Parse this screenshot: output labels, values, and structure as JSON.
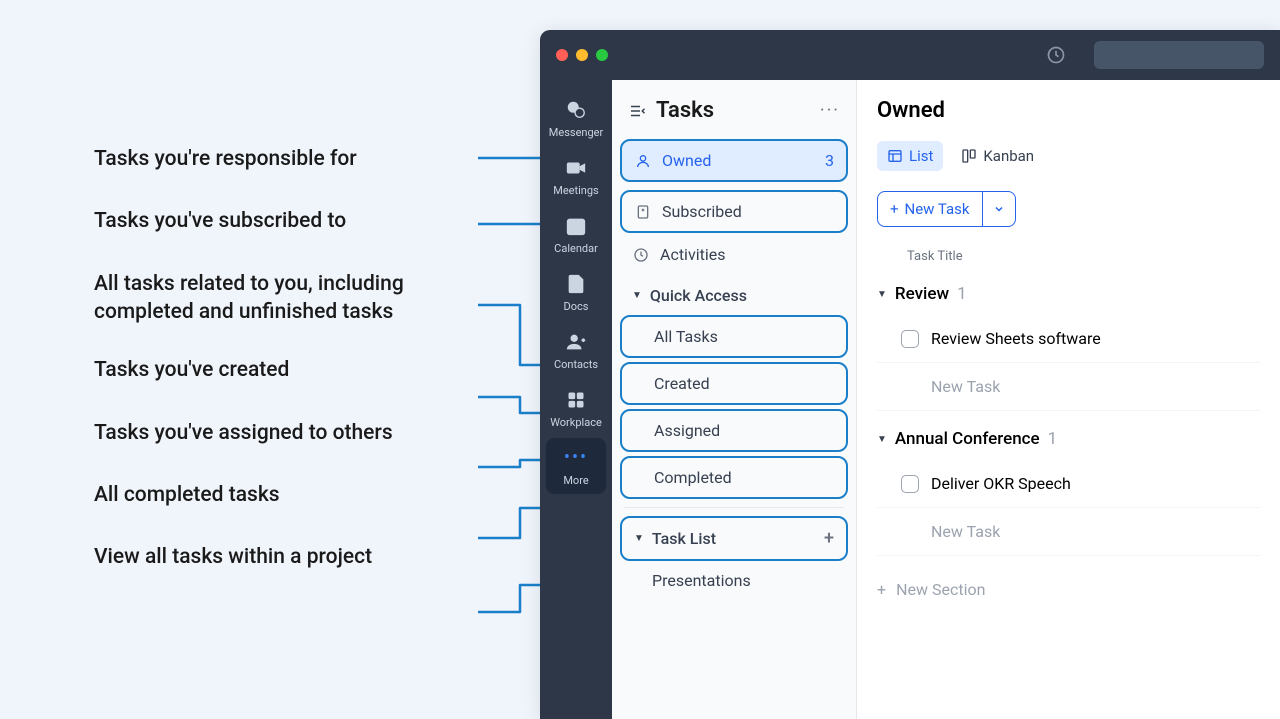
{
  "annotations": {
    "owned": "Tasks you're responsible for",
    "subscribed": "Tasks you've subscribed to",
    "all_tasks": "All tasks related to you, including completed and unfinished tasks",
    "created": "Tasks you've created",
    "assigned": "Tasks you've assigned to others",
    "completed": "All completed tasks",
    "task_list": "View all tasks within a project"
  },
  "nav": {
    "items": [
      {
        "label": "Messenger"
      },
      {
        "label": "Meetings"
      },
      {
        "label": "Calendar"
      },
      {
        "label": "Docs"
      },
      {
        "label": "Contacts"
      },
      {
        "label": "Workplace"
      },
      {
        "label": "More"
      }
    ]
  },
  "tasks_panel": {
    "title": "Tasks",
    "filters": {
      "owned": {
        "label": "Owned",
        "count": "3"
      },
      "subscribed": {
        "label": "Subscribed"
      },
      "activities": {
        "label": "Activities"
      }
    },
    "quick_access": {
      "header": "Quick Access",
      "items": [
        {
          "label": "All Tasks"
        },
        {
          "label": "Created"
        },
        {
          "label": "Assigned"
        },
        {
          "label": "Completed"
        }
      ]
    },
    "task_list": {
      "header": "Task List",
      "items": [
        {
          "label": "Presentations"
        }
      ]
    }
  },
  "main": {
    "title": "Owned",
    "tabs": {
      "list": "List",
      "kanban": "Kanban"
    },
    "new_task": "New Task",
    "col_title": "Task Title",
    "sections": [
      {
        "name": "Review",
        "count": "1",
        "tasks": [
          {
            "title": "Review Sheets software"
          }
        ]
      },
      {
        "name": "Annual Conference",
        "count": "1",
        "tasks": [
          {
            "title": "Deliver OKR Speech"
          }
        ]
      }
    ],
    "new_task_placeholder": "New Task",
    "new_section": "New Section"
  }
}
